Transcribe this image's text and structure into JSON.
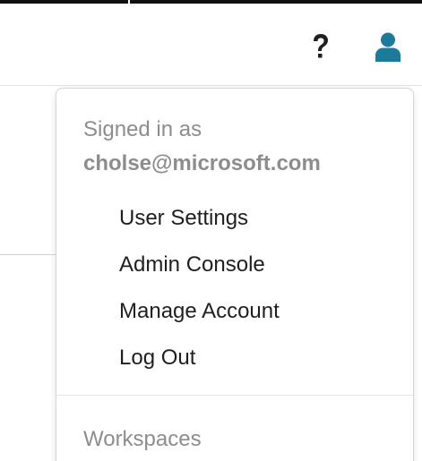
{
  "header": {
    "help_icon": "question-mark-icon",
    "user_icon": "user-icon",
    "user_icon_color": "#1d7a99"
  },
  "user_menu": {
    "signed_in_label": "Signed in as",
    "email": "cholse@microsoft.com",
    "items": [
      {
        "label": "User Settings"
      },
      {
        "label": "Admin Console"
      },
      {
        "label": "Manage Account"
      },
      {
        "label": "Log Out"
      }
    ],
    "workspaces_label": "Workspaces"
  }
}
